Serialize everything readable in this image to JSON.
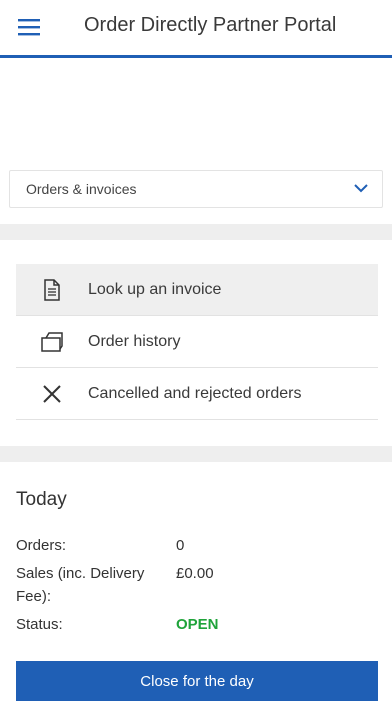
{
  "header": {
    "title": "Order Directly Partner Portal",
    "menu_icon": "hamburger-menu-icon",
    "accent_color": "#1f5fb5"
  },
  "section_select": {
    "value": "Orders & invoices",
    "icon": "chevron-down-icon"
  },
  "menu_list": {
    "items": [
      {
        "label": "Look up an invoice",
        "icon": "document-icon"
      },
      {
        "label": "Order history",
        "icon": "folder-icon"
      },
      {
        "label": "Cancelled and rejected orders",
        "icon": "close-icon"
      }
    ]
  },
  "today": {
    "title": "Today",
    "orders_label": "Orders:",
    "orders_value": "0",
    "sales_label_1": "Sales (inc. Delivery",
    "sales_label_2": "Fee):",
    "sales_value": "£0.00",
    "status_label": "Status:",
    "status_value": "OPEN",
    "status_color": "#1fa33a"
  },
  "actions": {
    "close_label": "Close for the day"
  }
}
